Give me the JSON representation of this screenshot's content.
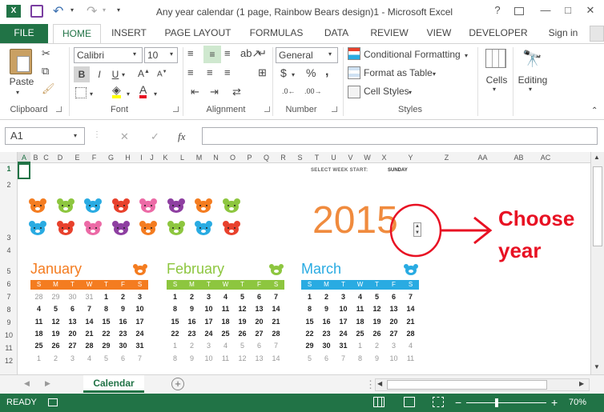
{
  "titlebar": {
    "title": "Any year calendar (1 page, Rainbow Bears design)1 - Microsoft Excel",
    "help": "?",
    "minimize": "—",
    "restore": "□",
    "close": "✕"
  },
  "tabs": [
    "FILE",
    "HOME",
    "INSERT",
    "PAGE LAYOUT",
    "FORMULAS",
    "DATA",
    "REVIEW",
    "VIEW",
    "DEVELOPER"
  ],
  "signin": "Sign in",
  "ribbon": {
    "paste": "Paste",
    "clipboard": "Clipboard",
    "font_name": "Calibri",
    "font_size": "10",
    "bold": "B",
    "italic": "I",
    "underline": "U",
    "font_group": "Font",
    "alignment_group": "Alignment",
    "number_format": "General",
    "currency": "$",
    "percent": "%",
    "comma": ",",
    "number_group": "Number",
    "conditional": "Conditional Formatting",
    "format_table": "Format as Table",
    "cell_styles": "Cell Styles",
    "styles_group": "Styles",
    "cells": "Cells",
    "editing": "Editing"
  },
  "formula": {
    "name_box": "A1",
    "cancel": "✕",
    "enter": "✓",
    "fx": "fx",
    "value": ""
  },
  "columns": [
    "A",
    "B",
    "C",
    "D",
    "E",
    "F",
    "G",
    "H",
    "I",
    "J",
    "K",
    "L",
    "M",
    "N",
    "O",
    "P",
    "Q",
    "R",
    "S",
    "T",
    "U",
    "V",
    "W",
    "X",
    "Y",
    "Z",
    "AA",
    "AB",
    "AC"
  ],
  "rows": [
    "1",
    "2",
    "3",
    "4",
    "5",
    "6",
    "7",
    "8",
    "9",
    "10",
    "11",
    "12"
  ],
  "sheet": {
    "week_start_label": "SELECT WEEK START:",
    "week_start_value": "SUNDAY",
    "year": "2015",
    "annotation": "Choose year",
    "annotation_line1": "Choose",
    "annotation_line2": "year"
  },
  "bear_colors_row1": [
    "#f47c20",
    "#8dc63f",
    "#29abe2",
    "#e8412c",
    "#ec6aa6",
    "#8e3fa1",
    "#f47c20",
    "#8dc63f"
  ],
  "bear_colors_row2": [
    "#29abe2",
    "#e8412c",
    "#ec6aa6",
    "#8e3fa1",
    "#f47c20",
    "#8dc63f",
    "#29abe2",
    "#e8412c"
  ],
  "weekdays": [
    "S",
    "M",
    "T",
    "W",
    "T",
    "F",
    "S"
  ],
  "months": [
    {
      "name": "January",
      "color": "#f47c20",
      "header": "#f47c20",
      "weeks": [
        [
          "28",
          "29",
          "30",
          "31",
          "1",
          "2",
          "3"
        ],
        [
          "4",
          "5",
          "6",
          "7",
          "8",
          "9",
          "10"
        ],
        [
          "11",
          "12",
          "13",
          "14",
          "15",
          "16",
          "17"
        ],
        [
          "18",
          "19",
          "20",
          "21",
          "22",
          "23",
          "24"
        ],
        [
          "25",
          "26",
          "27",
          "28",
          "29",
          "30",
          "31"
        ],
        [
          "1",
          "2",
          "3",
          "4",
          "5",
          "6",
          "7"
        ]
      ],
      "dim": [
        [
          1,
          1,
          1,
          1,
          0,
          0,
          0
        ],
        [
          0,
          0,
          0,
          0,
          0,
          0,
          0
        ],
        [
          0,
          0,
          0,
          0,
          0,
          0,
          0
        ],
        [
          0,
          0,
          0,
          0,
          0,
          0,
          0
        ],
        [
          0,
          0,
          0,
          0,
          0,
          0,
          0
        ],
        [
          1,
          1,
          1,
          1,
          1,
          1,
          1
        ]
      ]
    },
    {
      "name": "February",
      "color": "#8dc63f",
      "header": "#8dc63f",
      "weeks": [
        [
          "1",
          "2",
          "3",
          "4",
          "5",
          "6",
          "7"
        ],
        [
          "8",
          "9",
          "10",
          "11",
          "12",
          "13",
          "14"
        ],
        [
          "15",
          "16",
          "17",
          "18",
          "19",
          "20",
          "21"
        ],
        [
          "22",
          "23",
          "24",
          "25",
          "26",
          "27",
          "28"
        ],
        [
          "1",
          "2",
          "3",
          "4",
          "5",
          "6",
          "7"
        ],
        [
          "8",
          "9",
          "10",
          "11",
          "12",
          "13",
          "14"
        ]
      ],
      "dim": [
        [
          0,
          0,
          0,
          0,
          0,
          0,
          0
        ],
        [
          0,
          0,
          0,
          0,
          0,
          0,
          0
        ],
        [
          0,
          0,
          0,
          0,
          0,
          0,
          0
        ],
        [
          0,
          0,
          0,
          0,
          0,
          0,
          0
        ],
        [
          1,
          1,
          1,
          1,
          1,
          1,
          1
        ],
        [
          1,
          1,
          1,
          1,
          1,
          1,
          1
        ]
      ]
    },
    {
      "name": "March",
      "color": "#29abe2",
      "header": "#29abe2",
      "weeks": [
        [
          "1",
          "2",
          "3",
          "4",
          "5",
          "6",
          "7"
        ],
        [
          "8",
          "9",
          "10",
          "11",
          "12",
          "13",
          "14"
        ],
        [
          "15",
          "16",
          "17",
          "18",
          "19",
          "20",
          "21"
        ],
        [
          "22",
          "23",
          "24",
          "25",
          "26",
          "27",
          "28"
        ],
        [
          "29",
          "30",
          "31",
          "1",
          "2",
          "3",
          "4"
        ],
        [
          "5",
          "6",
          "7",
          "8",
          "9",
          "10",
          "11"
        ]
      ],
      "dim": [
        [
          0,
          0,
          0,
          0,
          0,
          0,
          0
        ],
        [
          0,
          0,
          0,
          0,
          0,
          0,
          0
        ],
        [
          0,
          0,
          0,
          0,
          0,
          0,
          0
        ],
        [
          0,
          0,
          0,
          0,
          0,
          0,
          0
        ],
        [
          0,
          0,
          0,
          1,
          1,
          1,
          1
        ],
        [
          1,
          1,
          1,
          1,
          1,
          1,
          1
        ]
      ]
    }
  ],
  "sheet_tab": "Calendar",
  "status": {
    "ready": "READY",
    "zoom": "70%",
    "zoom_minus": "−",
    "zoom_plus": "+"
  }
}
